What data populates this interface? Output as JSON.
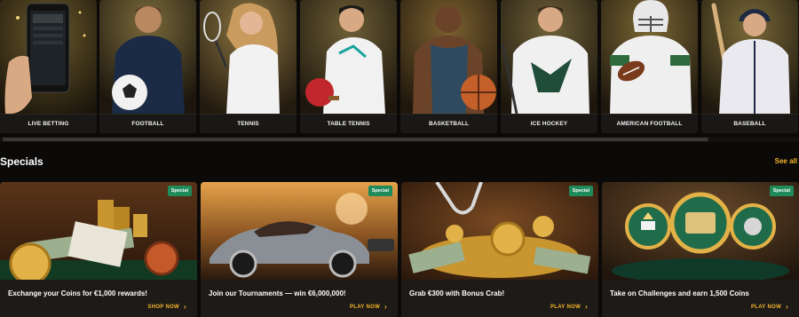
{
  "sports": [
    {
      "label": "LIVE BETTING",
      "icon": "phone-hand-icon"
    },
    {
      "label": "FOOTBALL",
      "icon": "football-player-icon"
    },
    {
      "label": "TENNIS",
      "icon": "tennis-player-icon"
    },
    {
      "label": "TABLE TENNIS",
      "icon": "table-tennis-player-icon"
    },
    {
      "label": "BASKETBALL",
      "icon": "basketball-player-icon"
    },
    {
      "label": "ICE HOCKEY",
      "icon": "ice-hockey-player-icon"
    },
    {
      "label": "AMERICAN FOOTBALL",
      "icon": "american-football-player-icon"
    },
    {
      "label": "BASEBALL",
      "icon": "baseball-player-icon"
    }
  ],
  "specials": {
    "title": "Specials",
    "see_all": "See all",
    "cards": [
      {
        "badge": "Special",
        "title": "Exchange your Coins for €1,000 rewards!",
        "cta": "SHOP NOW"
      },
      {
        "badge": "Special",
        "title": "Join our Tournaments — win €6,000,000!",
        "cta": "PLAY NOW"
      },
      {
        "badge": "Special",
        "title": "Grab €300 with Bonus Crab!",
        "cta": "PLAY NOW"
      },
      {
        "badge": "Special",
        "title": "Take on Challenges and earn 1,500 Coins",
        "cta": "PLAY NOW"
      }
    ]
  },
  "colors": {
    "accent": "#f5b52b",
    "badge": "#1f8a5a",
    "background": "#0b0a09"
  }
}
